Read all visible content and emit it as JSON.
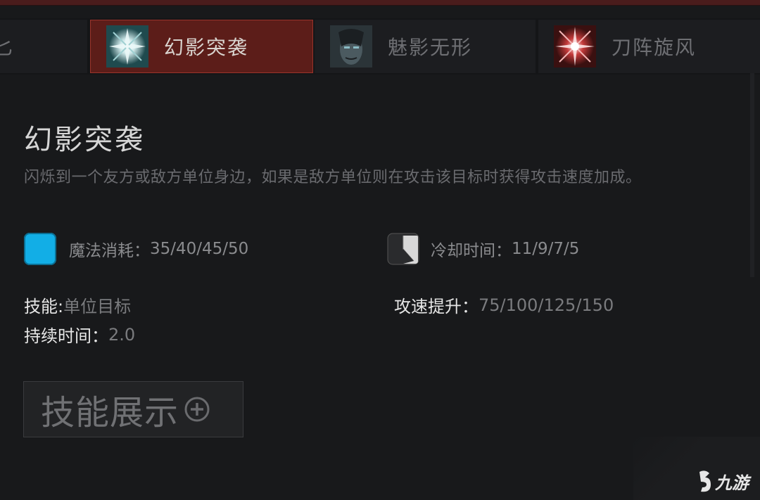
{
  "tabs": [
    {
      "label": "匕",
      "state": "inactive-partial"
    },
    {
      "label": "幻影突袭",
      "state": "active"
    },
    {
      "label": "魅影无形",
      "state": "inactive"
    },
    {
      "label": "刀阵旋风",
      "state": "inactive"
    }
  ],
  "skill": {
    "title": "幻影突袭",
    "description": "闪烁到一个友方或敌方单位身边，如果是敌方单位则在攻击该目标时获得攻击速度加成。",
    "mana": {
      "label": "魔法消耗：",
      "value": "35/40/45/50",
      "icon": "mana-icon"
    },
    "cooldown": {
      "label": "冷却时间：",
      "value": "11/9/7/5",
      "icon": "cooldown-icon"
    },
    "ability": {
      "label": "技能:",
      "value": "单位目标"
    },
    "attack_speed": {
      "label": "攻速提升：",
      "value": "75/100/125/150"
    },
    "duration": {
      "label": "持续时间：",
      "value": "2.0"
    }
  },
  "showcase_button": {
    "label": "技能展示",
    "icon": "plus-circle-icon"
  },
  "colors": {
    "active_tab_bg": "#5c1d19",
    "active_tab_border": "#9a342b",
    "mana_blue": "#12aee6",
    "background": "#18191b"
  },
  "watermark": {
    "text": "九游"
  }
}
